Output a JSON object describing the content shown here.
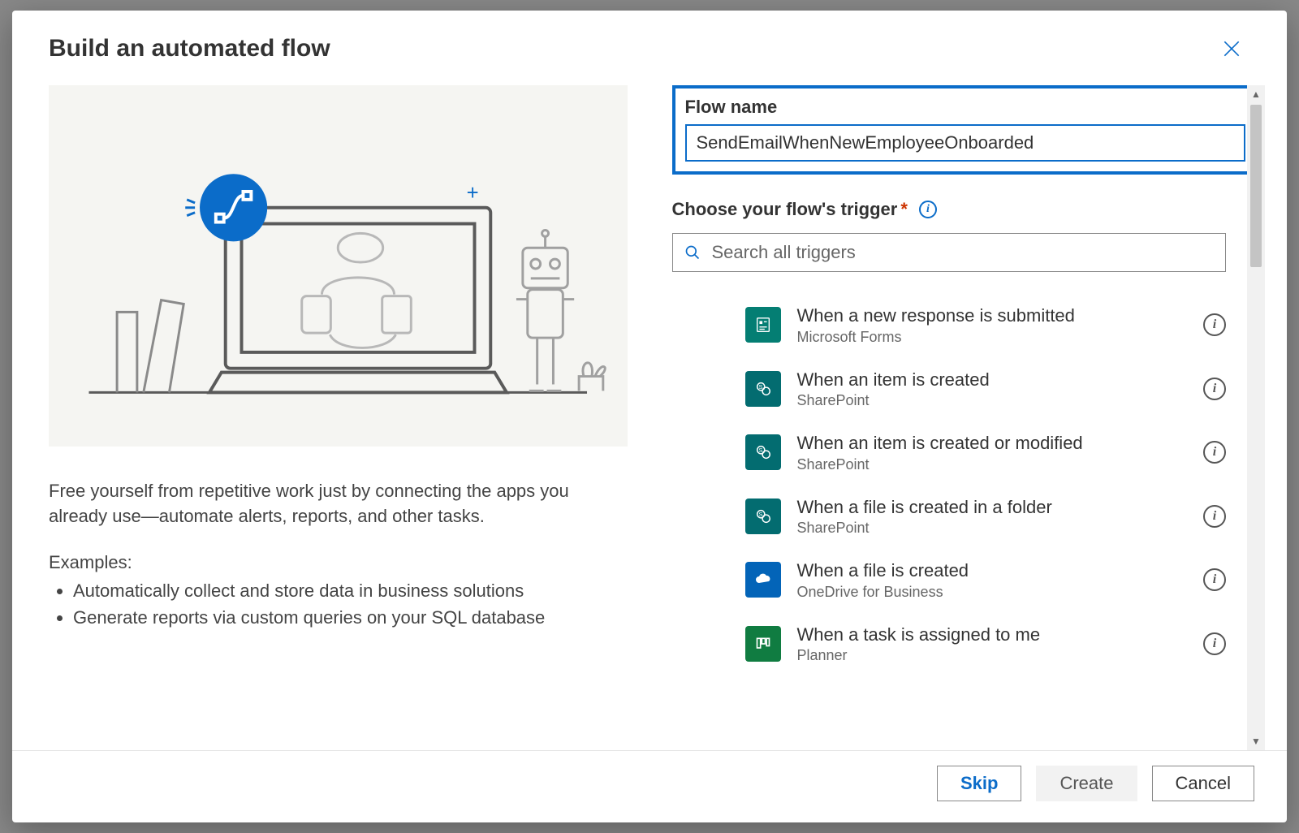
{
  "dialog": {
    "title": "Build an automated flow"
  },
  "left": {
    "description": "Free yourself from repetitive work just by connecting the apps you already use—automate alerts, reports, and other tasks.",
    "examples_label": "Examples:",
    "examples": [
      "Automatically collect and store data in business solutions",
      "Generate reports via custom queries on your SQL database"
    ]
  },
  "form": {
    "flow_name_label": "Flow name",
    "flow_name_value": "SendEmailWhenNewEmployeeOnboarded",
    "trigger_label": "Choose your flow's trigger",
    "search_placeholder": "Search all triggers"
  },
  "triggers": [
    {
      "title": "When a new response is submitted",
      "subtitle": "Microsoft Forms",
      "icon": "forms"
    },
    {
      "title": "When an item is created",
      "subtitle": "SharePoint",
      "icon": "sp"
    },
    {
      "title": "When an item is created or modified",
      "subtitle": "SharePoint",
      "icon": "sp2"
    },
    {
      "title": "When a file is created in a folder",
      "subtitle": "SharePoint",
      "icon": "sp2"
    },
    {
      "title": "When a file is created",
      "subtitle": "OneDrive for Business",
      "icon": "od"
    },
    {
      "title": "When a task is assigned to me",
      "subtitle": "Planner",
      "icon": "plan"
    }
  ],
  "footer": {
    "skip": "Skip",
    "create": "Create",
    "cancel": "Cancel"
  }
}
